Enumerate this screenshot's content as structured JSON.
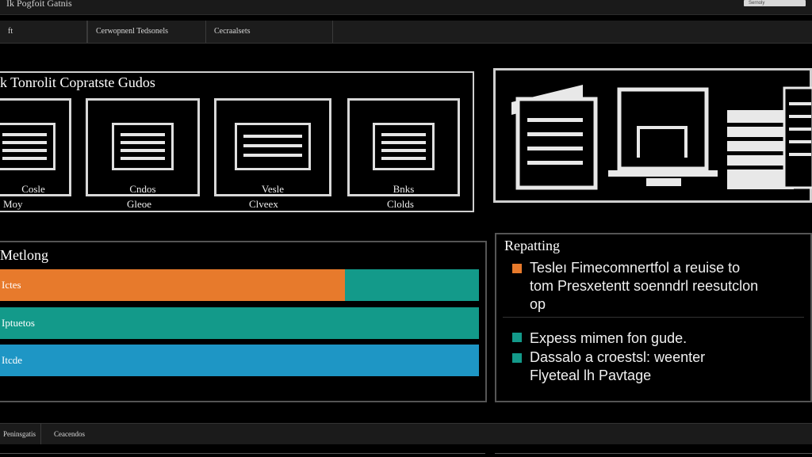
{
  "app": {
    "title": "Ik Pogfoit Gatnis",
    "search_placeholder": "Sernoly"
  },
  "tabs": [
    {
      "label": "ft"
    },
    {
      "label": "Cerwopnenl Tedsonels"
    },
    {
      "label": "Cecraalsets"
    }
  ],
  "top_panel": {
    "title": "k Tonrolit Copratste Gudos",
    "cards": [
      {
        "label": "Cosle",
        "sublabel": "Moy"
      },
      {
        "label": "Cndos",
        "sublabel": "Gleoe"
      },
      {
        "label": "Vesle",
        "sublabel": "Clveex"
      },
      {
        "label": "Bnks",
        "sublabel": "Clolds"
      }
    ]
  },
  "progress_panel": {
    "title": "Metlong",
    "bars": [
      {
        "label": "Ictes",
        "primary_fraction": 0.72,
        "primary_color": "#e77a2c",
        "secondary_color": "#139a8a"
      },
      {
        "label": "Iptuetos",
        "primary_fraction": 1.0,
        "primary_color": "#139a8a",
        "secondary_color": "#139a8a"
      },
      {
        "label": "Itcde",
        "primary_fraction": 1.0,
        "primary_color": "#1e96c5",
        "secondary_color": "#1e96c5"
      }
    ]
  },
  "info_panel": {
    "title": "Repatting",
    "items": [
      {
        "color": "#e77a2c",
        "lines": [
          "Tesleı Fimecomnertfol a reuise to",
          "tom Presxetentt soenndrl reesutclon",
          "op"
        ]
      },
      {
        "color": "#139a8a",
        "lines": [
          "Expess mimen fon gude."
        ]
      },
      {
        "color": "#139a8a",
        "lines": [
          "Dassalo a croestsl: weenter",
          "Flyeteal lh Pavtage"
        ]
      }
    ]
  },
  "bottom_bar": {
    "items": [
      {
        "label": "Peninsgatis"
      },
      {
        "label": "Ceacendos"
      }
    ]
  }
}
